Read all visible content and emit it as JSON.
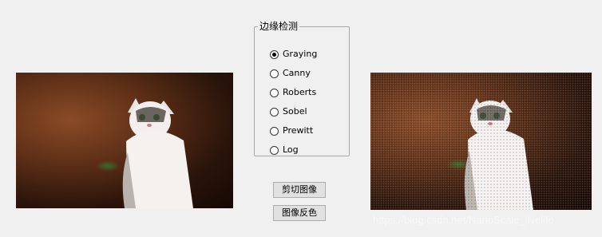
{
  "edge_detection": {
    "group_title": "边缘检测",
    "options": [
      {
        "label": "Graying",
        "selected": true
      },
      {
        "label": "Canny",
        "selected": false
      },
      {
        "label": "Roberts",
        "selected": false
      },
      {
        "label": "Sobel",
        "selected": false
      },
      {
        "label": "Prewitt",
        "selected": false
      },
      {
        "label": "Log",
        "selected": false
      }
    ]
  },
  "buttons": {
    "crop": "剪切图像",
    "invert": "图像反色"
  },
  "watermark": "https://blog.csdn.net/NanoScale_livelife",
  "images": {
    "left": "original-cat-photo",
    "right": "noisy-cat-photo"
  }
}
